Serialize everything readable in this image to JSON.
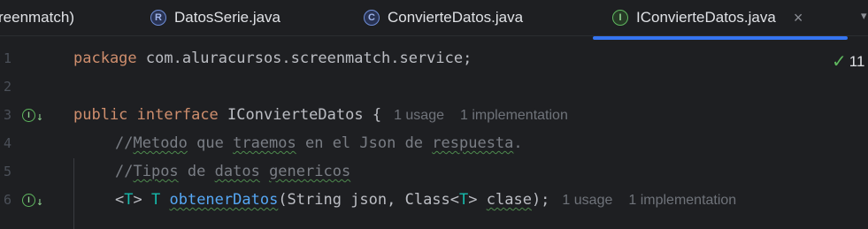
{
  "tabs": [
    {
      "label": "reenmatch)",
      "icon": null,
      "active": false
    },
    {
      "label": "DatosSerie.java",
      "icon": "record-icon",
      "icon_letter": "R",
      "active": false
    },
    {
      "label": "ConvierteDatos.java",
      "icon": "class-icon",
      "icon_letter": "C",
      "active": false
    },
    {
      "label": "IConvierteDatos.java",
      "icon": "interface-icon",
      "icon_letter": "I",
      "active": true
    }
  ],
  "close_glyph": "×",
  "overflow_glyph": "▾",
  "inspection": {
    "count": "11",
    "icon": "check-icon"
  },
  "gutter": {
    "impl_letter": "I",
    "impl_arrow": "↓"
  },
  "lines": {
    "n1": "1",
    "n2": "2",
    "n3": "3",
    "n4": "4",
    "n5": "5",
    "n6": "6",
    "l1_kw": "package",
    "l1_rest": " com.aluracursos.screenmatch.service;",
    "l3_kw1": "public",
    "l3_kw2": "interface",
    "l3_name": "IConvierteDatos",
    "l3_brace": " {",
    "l3_hint1": "1 usage",
    "l3_hint2": "1 implementation",
    "l4_slashes": "//",
    "l4_w1": "Metodo",
    "l4_s1": " que ",
    "l4_w2": "traemos",
    "l4_s2": " en el Json de ",
    "l4_w3": "respuesta",
    "l4_s3": ".",
    "l5_slashes": "//",
    "l5_w1": "Tipos",
    "l5_s1": " de ",
    "l5_w2": "datos",
    "l5_s2": " ",
    "l5_w3": "genericos",
    "l6_lt": "<",
    "l6_T1": "T",
    "l6_gt": "> ",
    "l6_T2": "T",
    "l6_sp": " ",
    "l6_fn": "obtenerDatos",
    "l6_args1": "(String json, Class<",
    "l6_T3": "T",
    "l6_args2": "> ",
    "l6_param": "clase",
    "l6_end": ");",
    "l6_hint1": "1 usage",
    "l6_hint2": "1 implementation"
  },
  "colors": {
    "background": "#1e1f22",
    "keyword": "#cf8e6d",
    "comment": "#7a7e85",
    "generic": "#16baac",
    "method": "#56a8f5",
    "accent": "#3574f0"
  }
}
